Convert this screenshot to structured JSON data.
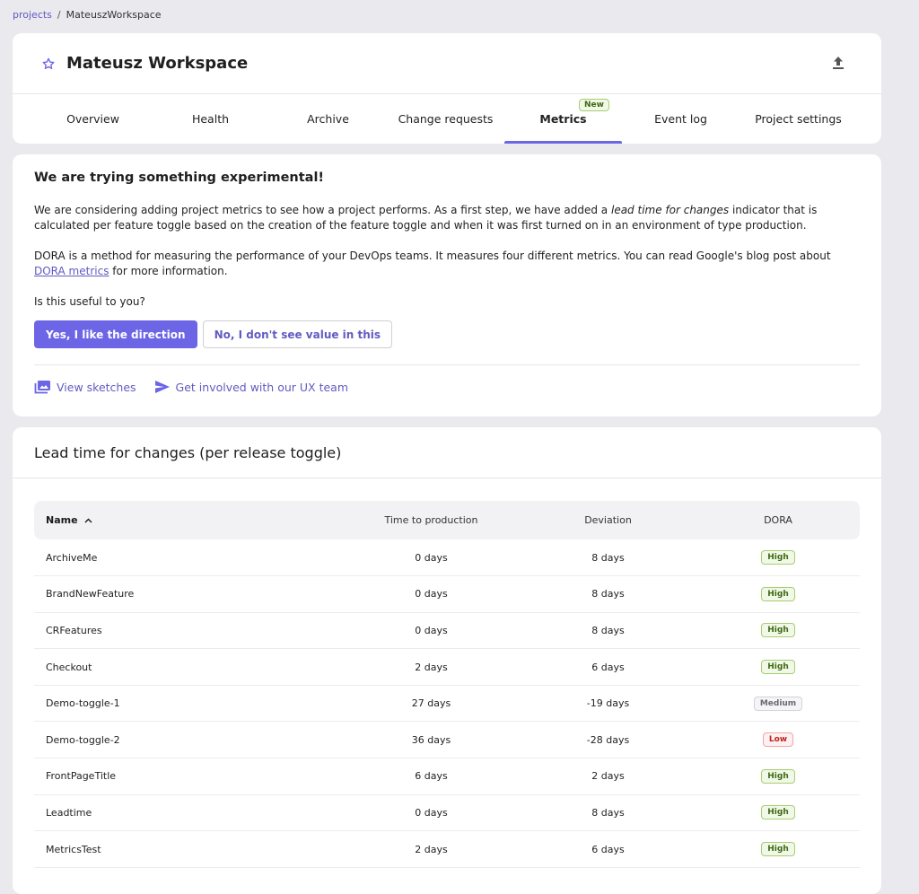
{
  "breadcrumb": {
    "root": "projects",
    "separator": "/",
    "current": "MateuszWorkspace"
  },
  "header": {
    "title": "Mateusz Workspace",
    "favorite_icon": "star-outline-icon",
    "export_icon": "upload-icon"
  },
  "tabs": [
    {
      "label": "Overview",
      "active": false
    },
    {
      "label": "Health",
      "active": false
    },
    {
      "label": "Archive",
      "active": false
    },
    {
      "label": "Change requests",
      "active": false
    },
    {
      "label": "Metrics",
      "active": true,
      "badge": "New"
    },
    {
      "label": "Event log",
      "active": false
    },
    {
      "label": "Project settings",
      "active": false
    }
  ],
  "experimental": {
    "title": "We are trying something experimental!",
    "p1_before": "We are considering adding project metrics to see how a project performs. As a first step, we have added a ",
    "p1_em": "lead time for changes",
    "p1_after": " indicator that is calculated per feature toggle based on the creation of the feature toggle and when it was first turned on in an environment of type production.",
    "p2_before": "DORA is a method for measuring the performance of your DevOps teams. It measures four different metrics. You can read Google's blog post about ",
    "p2_link": "DORA metrics",
    "p2_after": " for more information.",
    "question": "Is this useful to you?",
    "yes_label": "Yes, I like the direction",
    "no_label": "No, I don't see value in this",
    "view_sketches": "View sketches",
    "get_involved": "Get involved with our UX team"
  },
  "lead_time": {
    "title": "Lead time for changes (per release toggle)",
    "columns": {
      "name": "Name",
      "time": "Time to production",
      "deviation": "Deviation",
      "dora": "DORA"
    },
    "rows": [
      {
        "name": "ArchiveMe",
        "time": "0 days",
        "deviation": "8 days",
        "dora": "High"
      },
      {
        "name": "BrandNewFeature",
        "time": "0 days",
        "deviation": "8 days",
        "dora": "High"
      },
      {
        "name": "CRFeatures",
        "time": "0 days",
        "deviation": "8 days",
        "dora": "High"
      },
      {
        "name": "Checkout",
        "time": "2 days",
        "deviation": "6 days",
        "dora": "High"
      },
      {
        "name": "Demo-toggle-1",
        "time": "27 days",
        "deviation": "-19 days",
        "dora": "Medium"
      },
      {
        "name": "Demo-toggle-2",
        "time": "36 days",
        "deviation": "-28 days",
        "dora": "Low"
      },
      {
        "name": "FrontPageTitle",
        "time": "6 days",
        "deviation": "2 days",
        "dora": "High"
      },
      {
        "name": "Leadtime",
        "time": "0 days",
        "deviation": "8 days",
        "dora": "High"
      },
      {
        "name": "MetricsTest",
        "time": "2 days",
        "deviation": "6 days",
        "dora": "High"
      }
    ]
  },
  "colors": {
    "accent": "#6c65e5",
    "link": "#615bc2",
    "background": "#e9e9ee"
  }
}
